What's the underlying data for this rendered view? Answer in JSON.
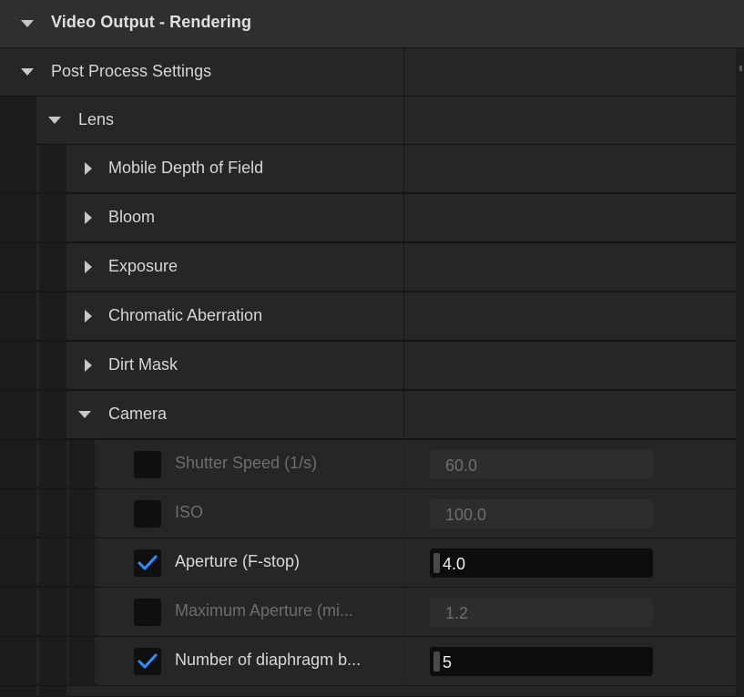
{
  "header": {
    "title": "Video Output - Rendering",
    "arrow_icon": "triangle-down-icon"
  },
  "categories": {
    "post_process": "Post Process Settings",
    "lens": "Lens",
    "mobile_dof": "Mobile Depth of Field",
    "bloom": "Bloom",
    "exposure": "Exposure",
    "chromatic_aberration": "Chromatic Aberration",
    "dirt_mask": "Dirt Mask",
    "camera": "Camera"
  },
  "properties": [
    {
      "label": "Shutter Speed (1/s)",
      "value": "60.0",
      "checked": false,
      "enabled": false
    },
    {
      "label": "ISO",
      "value": "100.0",
      "checked": false,
      "enabled": false
    },
    {
      "label": "Aperture (F-stop)",
      "value": "4.0",
      "checked": true,
      "enabled": true
    },
    {
      "label": "Maximum Aperture (mi...",
      "value": "1.2",
      "checked": false,
      "enabled": false
    },
    {
      "label": "Number of diaphragm b...",
      "value": "5",
      "checked": true,
      "enabled": true
    }
  ],
  "colors": {
    "accent_check": "#2f8fff",
    "panel_bg": "#262626",
    "header_bg": "#2f2f2f"
  }
}
